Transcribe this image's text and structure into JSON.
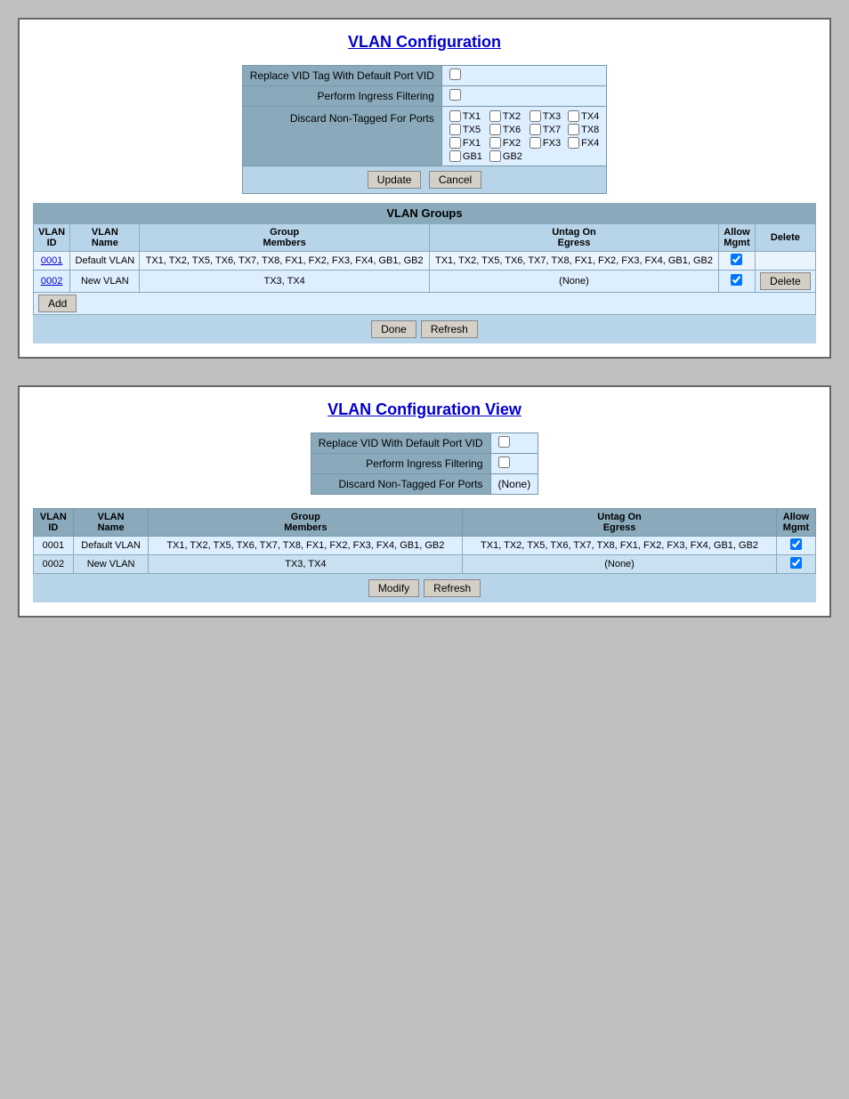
{
  "panel1": {
    "title": "VLAN Configuration",
    "form": {
      "replace_vid_label": "Replace VID Tag With Default Port VID",
      "ingress_label": "Perform Ingress Filtering",
      "discard_label": "Discard Non-Tagged For Ports",
      "tx_ports": [
        "TX1",
        "TX2",
        "TX3",
        "TX4",
        "TX5",
        "TX6",
        "TX7",
        "TX8",
        "FX1",
        "FX2",
        "FX3",
        "FX4",
        "GB1",
        "GB2"
      ],
      "update_btn": "Update",
      "cancel_btn": "Cancel"
    },
    "groups_header": "VLAN Groups",
    "table": {
      "headers": [
        "VLAN\nID",
        "VLAN\nName",
        "Group\nMembers",
        "Untag On\nEgress",
        "Allow\nMgmt",
        "Delete"
      ],
      "rows": [
        {
          "id": "0001",
          "name": "Default VLAN",
          "members": "TX1, TX2, TX5, TX6, TX7, TX8, FX1, FX2, FX3, FX4, GB1, GB2",
          "untag": "TX1, TX2, TX5, TX6, TX7, TX8, FX1, FX2, FX3, FX4, GB1, GB2",
          "allow_mgmt": true,
          "delete": false
        },
        {
          "id": "0002",
          "name": "New VLAN",
          "members": "TX3, TX4",
          "untag": "(None)",
          "allow_mgmt": true,
          "delete": true
        }
      ]
    },
    "add_btn": "Add",
    "done_btn": "Done",
    "refresh_btn": "Refresh"
  },
  "panel2": {
    "title": "VLAN Configuration View",
    "form": {
      "replace_vid_label": "Replace VID With Default Port VID",
      "ingress_label": "Perform Ingress Filtering",
      "discard_label": "Discard Non-Tagged For Ports",
      "discard_value": "(None)"
    },
    "table": {
      "headers": [
        "VLAN\nID",
        "VLAN\nName",
        "Group\nMembers",
        "Untag On\nEgress",
        "Allow\nMgmt"
      ],
      "rows": [
        {
          "id": "0001",
          "name": "Default VLAN",
          "members": "TX1, TX2, TX5, TX6, TX7, TX8, FX1, FX2, FX3, FX4, GB1, GB2",
          "untag": "TX1, TX2, TX5, TX6, TX7, TX8, FX1, FX2, FX3, FX4, GB1, GB2",
          "allow_mgmt": true
        },
        {
          "id": "0002",
          "name": "New VLAN",
          "members": "TX3, TX4",
          "untag": "(None)",
          "allow_mgmt": true
        }
      ]
    },
    "modify_btn": "Modify",
    "refresh_btn": "Refresh"
  }
}
